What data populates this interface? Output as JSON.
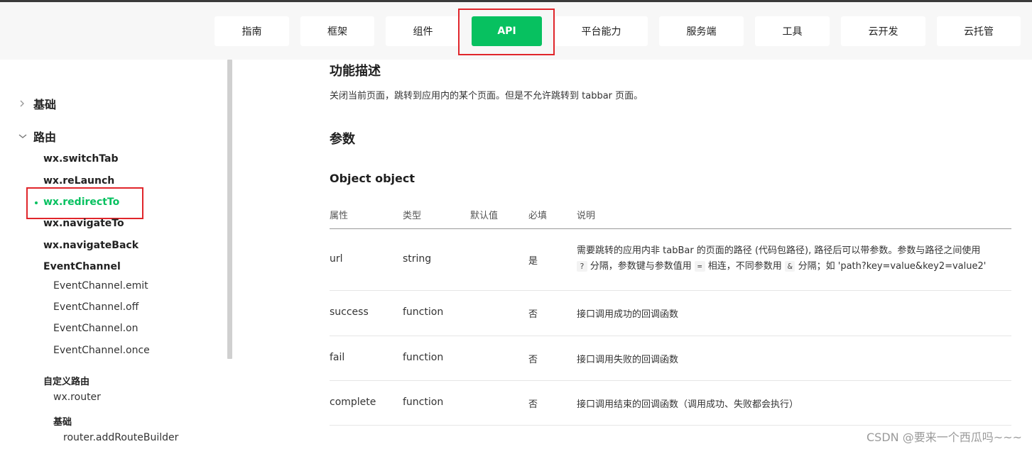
{
  "nav": {
    "items": [
      "指南",
      "框架",
      "组件",
      "API",
      "平台能力",
      "服务端",
      "工具",
      "云开发",
      "云托管"
    ],
    "active": "API"
  },
  "sidebar": {
    "groups": [
      {
        "label": "基础",
        "expanded": false
      },
      {
        "label": "路由",
        "expanded": true
      }
    ],
    "route_items": [
      "wx.switchTab",
      "wx.reLaunch",
      "wx.redirectTo",
      "wx.navigateTo",
      "wx.navigateBack"
    ],
    "active_item": "wx.redirectTo",
    "event_channel": {
      "label": "EventChannel",
      "items": [
        "EventChannel.emit",
        "EventChannel.off",
        "EventChannel.on",
        "EventChannel.once"
      ]
    },
    "custom_route": {
      "label": "自定义路由",
      "router": "wx.router",
      "basic_label": "基础",
      "basic_items": [
        "router.addRouteBuilder"
      ]
    }
  },
  "content": {
    "section_desc_title": "功能描述",
    "section_desc_text": "关闭当前页面，跳转到应用内的某个页面。但是不允许跳转到 tabbar 页面。",
    "section_params_title": "参数",
    "object_title": "Object object",
    "table": {
      "headers": [
        "属性",
        "类型",
        "默认值",
        "必填",
        "说明"
      ],
      "rows": [
        {
          "name": "url",
          "type": "string",
          "default": "",
          "required": "是",
          "desc_line1": "需要跳转的应用内非 tabBar 的页面的路径 (代码包路径), 路径后可以带参数。参数与路径之间使用",
          "desc_line2_parts": [
            "?",
            "分隔，参数键与参数值用",
            "=",
            "相连，不同参数用",
            "&",
            "分隔；如 'path?key=value&key2=value2'"
          ]
        },
        {
          "name": "success",
          "type": "function",
          "default": "",
          "required": "否",
          "desc": "接口调用成功的回调函数"
        },
        {
          "name": "fail",
          "type": "function",
          "default": "",
          "required": "否",
          "desc": "接口调用失败的回调函数"
        },
        {
          "name": "complete",
          "type": "function",
          "default": "",
          "required": "否",
          "desc": "接口调用结束的回调函数（调用成功、失败都会执行）"
        }
      ]
    }
  },
  "watermark": "CSDN @要来一个西瓜吗~~~",
  "colors": {
    "accent": "#07c160",
    "highlight_box": "#e0262b"
  }
}
